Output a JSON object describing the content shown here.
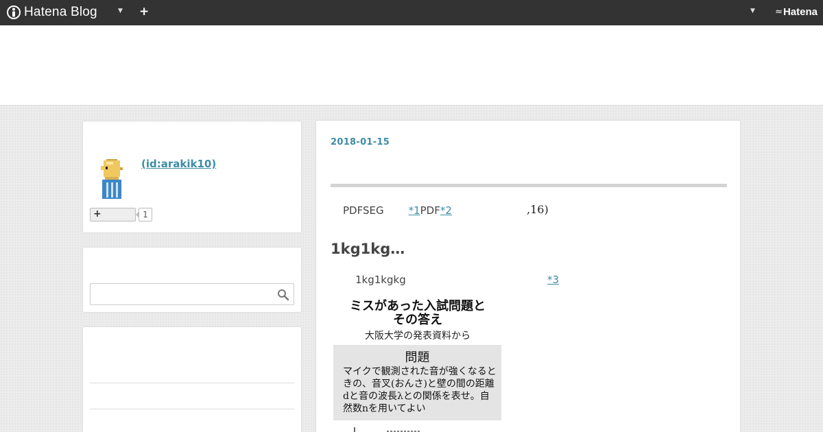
{
  "navbar": {
    "logo_text": "Hatena Blog",
    "add_label": "+",
    "hatena_label": "Hatena"
  },
  "profile": {
    "id_text": " (id:arakik10)",
    "reader_button_label": "+",
    "reader_count": "1"
  },
  "search": {
    "placeholder": ""
  },
  "entry": {
    "date": "2018-01-15",
    "p1_text": "PDFSEG",
    "p1_fn1": "*1",
    "p1_mid": "PDF",
    "p1_fn2": "*2",
    "p1_tail": ",16)",
    "heading": "1kg1kg…",
    "p2_text": "1kg1kgkg",
    "p2_fn3": "*3"
  },
  "news_image": {
    "headline_line1": "ミスがあった入試問題と",
    "headline_line2": "その答え",
    "subheadline": "大阪大学の発表資料から",
    "question_title": "問題",
    "question_body": "マイクで観測された音が強くなるときの、音叉(おんさ)と壁の間の距離dと音の波長λとの関係を表せ。自然数nを用いてよい"
  },
  "colors": {
    "navbar_bg": "#333333",
    "link": "#3d8ca6",
    "page_bg": "#ececec"
  }
}
